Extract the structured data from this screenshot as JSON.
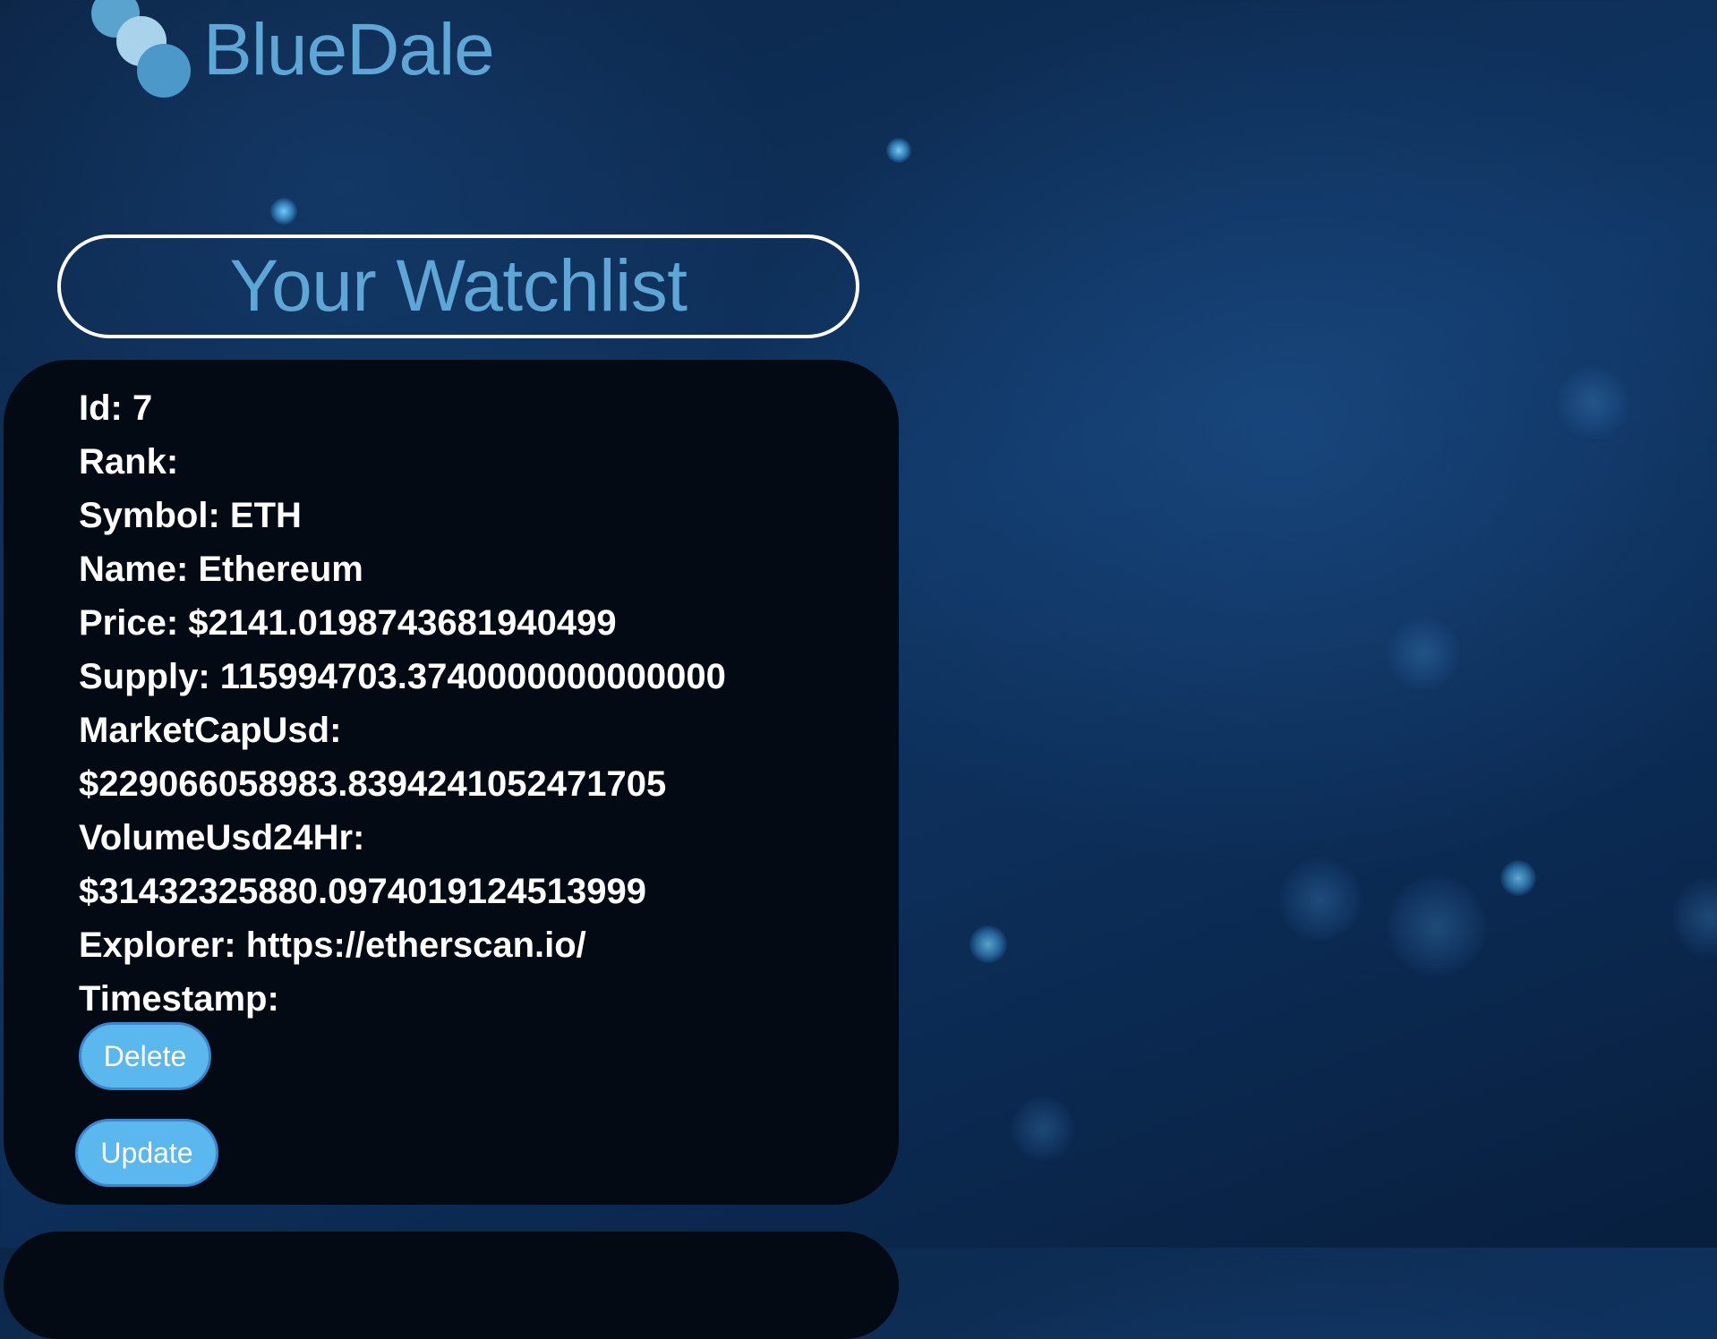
{
  "brand": {
    "name": "BlueDale"
  },
  "watchlist": {
    "title": "Your Watchlist"
  },
  "card": {
    "rows": [
      "Id: 7",
      "Rank:",
      "Symbol: ETH",
      "Name: Ethereum",
      "Price: $2141.0198743681940499",
      "Supply: 115994703.3740000000000000",
      "MarketCapUsd:",
      "$229066058983.8394241052471705",
      "VolumeUsd24Hr:",
      "$31432325880.0974019124513999",
      "Explorer: https://etherscan.io/",
      "Timestamp:"
    ],
    "delete_label": "Delete",
    "update_label": "Update"
  },
  "colors": {
    "accent": "#5ea6d6",
    "button": "#5bb8ef",
    "card_bg": "#040a14"
  }
}
